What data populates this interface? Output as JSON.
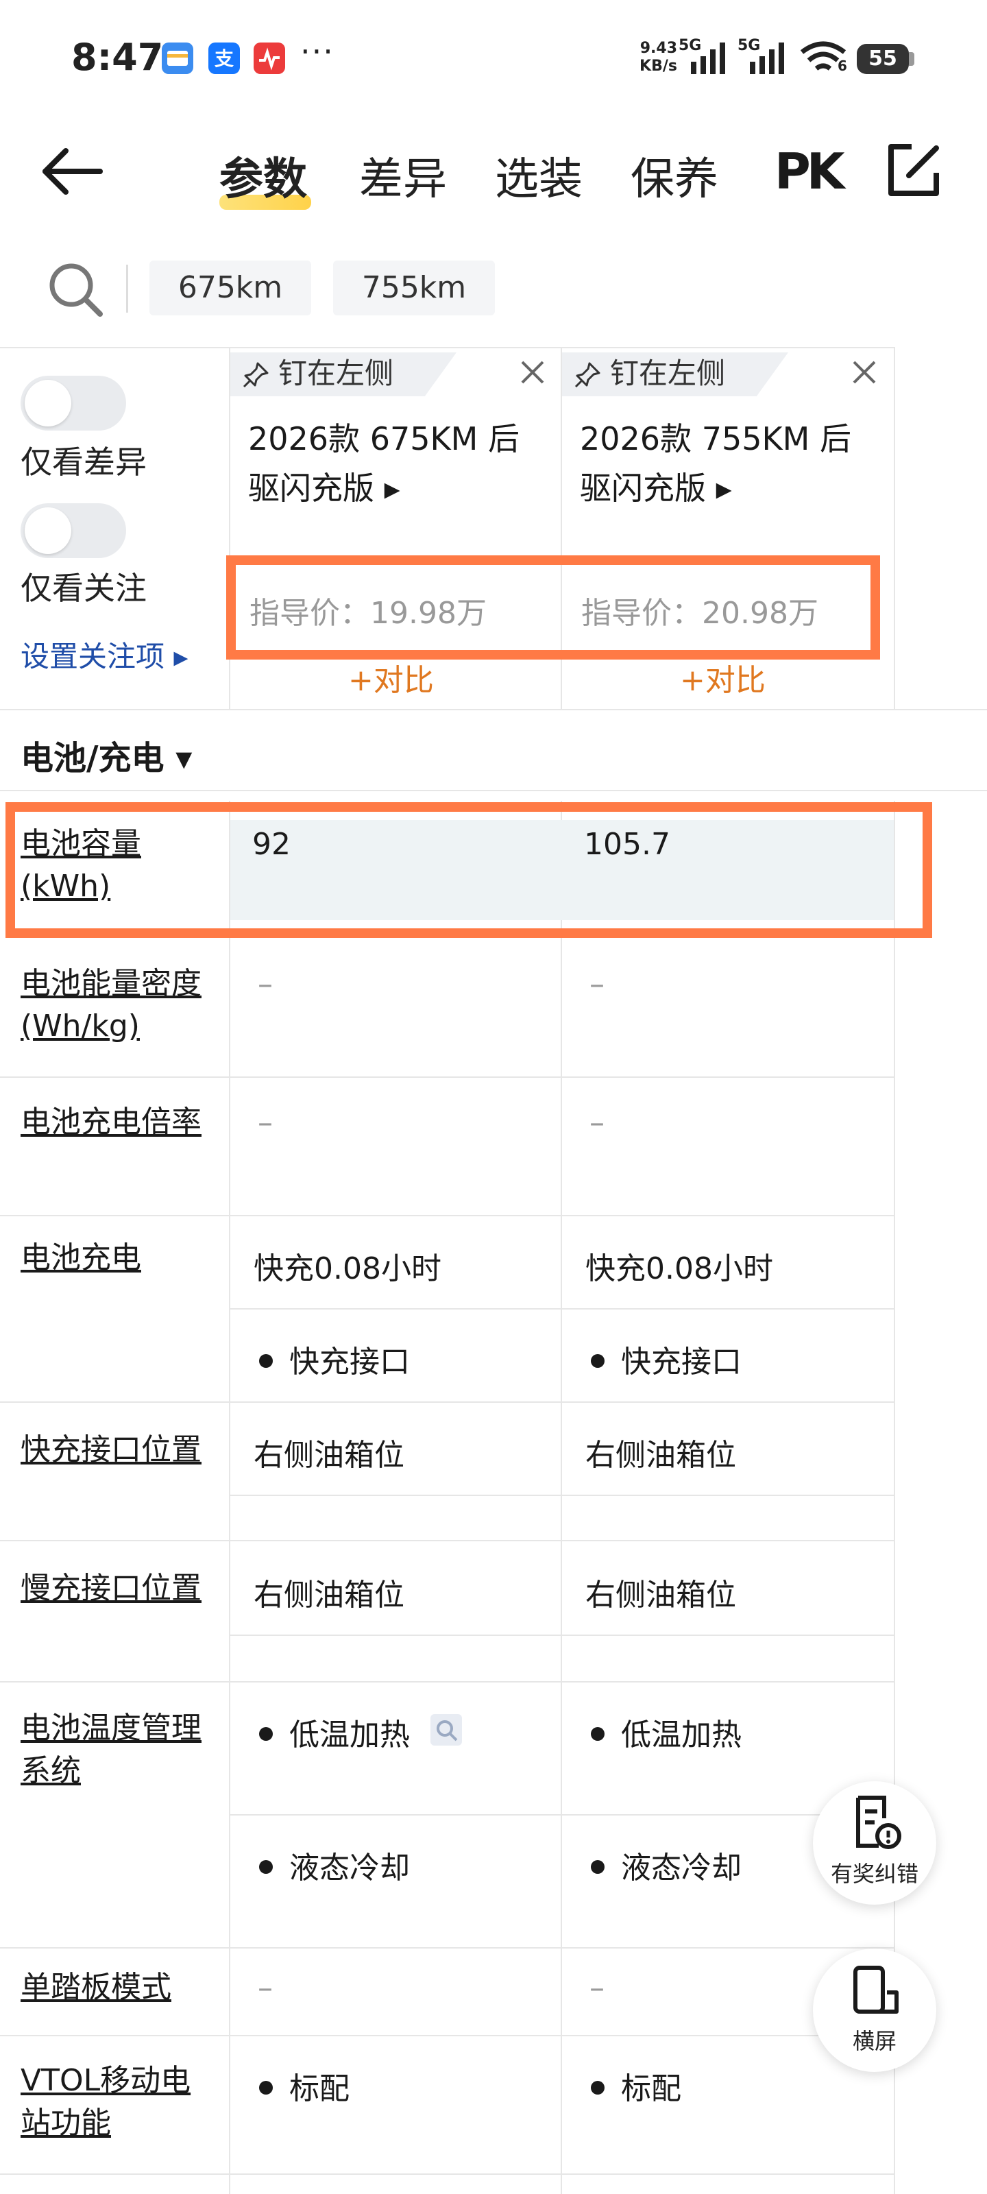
{
  "status_bar": {
    "time": "8:47",
    "more": "···",
    "net_speed_value": "9.43",
    "net_speed_unit": "KB/s",
    "sim1_label": "5G",
    "sim2_label": "5G",
    "wifi_label": "6",
    "battery": "55",
    "app_icons": [
      "wallet-app-icon",
      "alipay-app-icon",
      "health-app-icon"
    ]
  },
  "nav": {
    "tabs": [
      "参数",
      "差异",
      "选装",
      "保养"
    ],
    "active_tab": "参数",
    "pk_label": "PK"
  },
  "search": {
    "chips": [
      "675km",
      "755km"
    ]
  },
  "filters": {
    "only_diff_label": "仅看差异",
    "only_follow_label": "仅看关注",
    "settings_link": "设置关注项 ▸"
  },
  "cars": [
    {
      "pin_label": "钉在左侧",
      "name": "2026款 675KM 后驱闪充版 ▸",
      "price": "指导价：19.98万",
      "compare_label": "+对比"
    },
    {
      "pin_label": "钉在左侧",
      "name": "2026款 755KM 后驱闪充版 ▸",
      "price": "指导价：20.98万",
      "compare_label": "+对比"
    }
  ],
  "section": {
    "title": "电池/充电 ▾"
  },
  "rows": {
    "battery_capacity": {
      "label": "电池容量(kWh)",
      "values": [
        "92",
        "105.7"
      ]
    },
    "energy_density": {
      "label": "电池能量密度(Wh/kg)",
      "values": [
        "–",
        "–"
      ]
    },
    "charge_rate": {
      "label": "电池充电倍率",
      "values": [
        "–",
        "–"
      ]
    },
    "battery_charging": {
      "label": "电池充电",
      "values": [
        "快充0.08小时",
        "快充0.08小时"
      ],
      "sub_values": [
        "快充接口",
        "快充接口"
      ]
    },
    "fast_port_location": {
      "label": "快充接口位置",
      "values": [
        "右侧油箱位",
        "右侧油箱位"
      ]
    },
    "slow_port_location": {
      "label": "慢充接口位置",
      "values": [
        "右侧油箱位",
        "右侧油箱位"
      ]
    },
    "thermal_management": {
      "label": "电池温度管理系统",
      "values": [
        "低温加热",
        "低温加热"
      ],
      "sub_values": [
        "液态冷却",
        "液态冷却"
      ]
    },
    "one_pedal": {
      "label": "单踏板模式",
      "values": [
        "–",
        "–"
      ]
    },
    "vtol": {
      "label": "VTOL移动电站功能",
      "values": [
        "标配",
        "标配"
      ]
    }
  },
  "fabs": {
    "report_label": "有奖纠错",
    "landscape_label": "横屏"
  },
  "colors": {
    "accent_orange": "#ff7a45",
    "link_blue": "#1f4da8",
    "compare_orange": "#e07820",
    "tab_underline": "#ffd24a"
  }
}
